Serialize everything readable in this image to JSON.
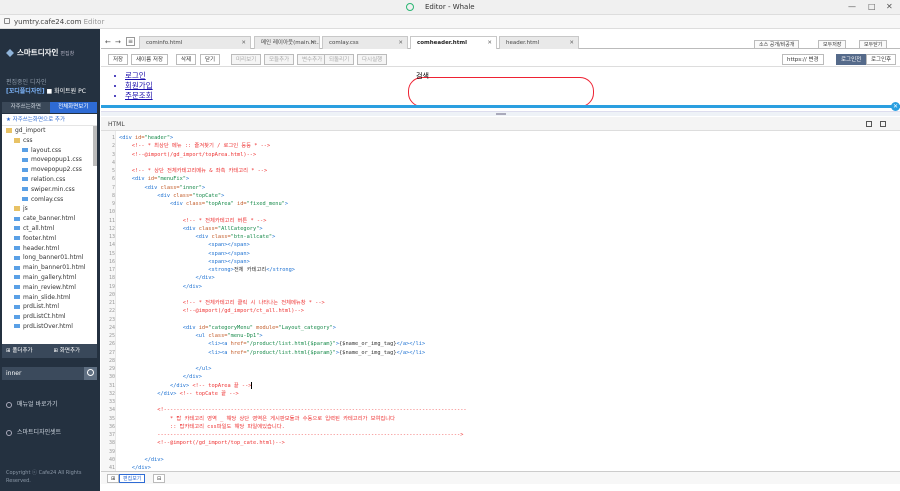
{
  "window": {
    "title": "Editor - Whale",
    "minimize": "—",
    "maximize": "□",
    "close": "✕"
  },
  "address": {
    "url": "yumtry.cafe24.com",
    "suffix": " Editor"
  },
  "sidebar": {
    "brand": "스마트디자인",
    "brand_sub": "편집창",
    "design_label": "편집중인 디자인",
    "design_name_prefix": "[꼬디플디자인]",
    "design_name": "■ 화이트원 PC",
    "tabs": [
      "자주쓰는화면",
      "전체화면보기"
    ],
    "favorites_add": "★ 자주쓰는화면으로 추가",
    "tree": [
      {
        "label": "gd_import",
        "type": "folder",
        "depth": 0
      },
      {
        "label": "css",
        "type": "folder",
        "depth": 1
      },
      {
        "label": "layout.css",
        "type": "file",
        "depth": 2
      },
      {
        "label": "movepopup1.css",
        "type": "file",
        "depth": 2
      },
      {
        "label": "movepopup2.css",
        "type": "file",
        "depth": 2
      },
      {
        "label": "relation.css",
        "type": "file",
        "depth": 2
      },
      {
        "label": "swiper.min.css",
        "type": "file",
        "depth": 2
      },
      {
        "label": "comlay.css",
        "type": "file",
        "depth": 2
      },
      {
        "label": "js",
        "type": "folder",
        "depth": 1
      },
      {
        "label": "cate_banner.html",
        "type": "file",
        "depth": 1
      },
      {
        "label": "ct_all.html",
        "type": "file",
        "depth": 1
      },
      {
        "label": "footer.html",
        "type": "file",
        "depth": 1
      },
      {
        "label": "header.html",
        "type": "file",
        "depth": 1
      },
      {
        "label": "long_banner01.html",
        "type": "file",
        "depth": 1
      },
      {
        "label": "main_banner01.html",
        "type": "file",
        "depth": 1
      },
      {
        "label": "main_gallery.html",
        "type": "file",
        "depth": 1
      },
      {
        "label": "main_review.html",
        "type": "file",
        "depth": 1
      },
      {
        "label": "main_slide.html",
        "type": "file",
        "depth": 1
      },
      {
        "label": "prdList.html",
        "type": "file",
        "depth": 1
      },
      {
        "label": "prdListCt.html",
        "type": "file",
        "depth": 1
      },
      {
        "label": "prdListOver.html",
        "type": "file",
        "depth": 1
      }
    ],
    "add_buttons": [
      "⊞ 폴더추가",
      "⊞ 화면추가"
    ],
    "search_value": "inner",
    "links": [
      "매뉴얼 바로가기",
      "스마트디자인셋트"
    ],
    "copyright": "Copyright ⓒ Cafe24 All Rights Reserved."
  },
  "tabs": [
    {
      "label": "cominfo.html",
      "active": false
    },
    {
      "label": "메인 레이아웃(main.ht...",
      "active": false
    },
    {
      "label": "comlay.css",
      "active": false
    },
    {
      "label": "comheader.html",
      "active": true
    },
    {
      "label": "header.html",
      "active": false
    }
  ],
  "tab_nav": {
    "back": "←",
    "forward": "→",
    "list": "≡"
  },
  "right_buttons": [
    "소스 공개/비공개",
    "모두저장",
    "모두닫기"
  ],
  "toolbar": {
    "left": [
      "저장",
      "새이름 저장",
      "삭제",
      "닫기"
    ],
    "mid": [
      "미리보기",
      "모듈추가",
      "변수추가",
      "되돌리기",
      "다시실행"
    ],
    "https": "https:// 변경",
    "right": [
      "로그인전",
      "로그인후"
    ]
  },
  "preview": {
    "links": [
      "로그인",
      "회원가입",
      "주문조회"
    ],
    "search_label": "검색"
  },
  "editor": {
    "mode": "HTML",
    "bottom": [
      "⊞",
      "편집보기",
      "⊟"
    ],
    "lines": [
      [
        [
          "t",
          "<div "
        ],
        [
          "a",
          "id="
        ],
        [
          "v",
          "\"header\""
        ],
        [
          "t",
          ">"
        ]
      ],
      [
        [
          "k",
          "    "
        ],
        [
          "c",
          "<!-- * 최상단 메뉴 :: 즐겨찾기 / 로그인 등등 * -->"
        ]
      ],
      [
        [
          "k",
          "    "
        ],
        [
          "c",
          "<!--@import(/gd_import/topArea.html)-->"
        ]
      ],
      [],
      [
        [
          "k",
          "    "
        ],
        [
          "c",
          "<!-- * 상단 전체카테고리메뉴 & 좌측 카테고리 * -->"
        ]
      ],
      [
        [
          "k",
          "    "
        ],
        [
          "t",
          "<div "
        ],
        [
          "a",
          "id="
        ],
        [
          "v",
          "\"menuFix\""
        ],
        [
          "t",
          ">"
        ]
      ],
      [
        [
          "k",
          "        "
        ],
        [
          "t",
          "<div "
        ],
        [
          "a",
          "class="
        ],
        [
          "v",
          "\"inner\""
        ],
        [
          "t",
          ">"
        ]
      ],
      [
        [
          "k",
          "            "
        ],
        [
          "t",
          "<div "
        ],
        [
          "a",
          "class="
        ],
        [
          "v",
          "\"topCate\""
        ],
        [
          "t",
          ">"
        ]
      ],
      [
        [
          "k",
          "                "
        ],
        [
          "t",
          "<div "
        ],
        [
          "a",
          "class="
        ],
        [
          "v",
          "\"topArea\" "
        ],
        [
          "a",
          "id="
        ],
        [
          "v",
          "\"fixed_menu\""
        ],
        [
          "t",
          ">"
        ]
      ],
      [],
      [
        [
          "k",
          "                    "
        ],
        [
          "c",
          "<!-- * 전체카테고리 버튼 * -->"
        ]
      ],
      [
        [
          "k",
          "                    "
        ],
        [
          "t",
          "<div "
        ],
        [
          "a",
          "class="
        ],
        [
          "v",
          "\"AllCategory\""
        ],
        [
          "t",
          ">"
        ]
      ],
      [
        [
          "k",
          "                        "
        ],
        [
          "t",
          "<div "
        ],
        [
          "a",
          "class="
        ],
        [
          "v",
          "\"btn-allcate\""
        ],
        [
          "t",
          ">"
        ]
      ],
      [
        [
          "k",
          "                            "
        ],
        [
          "t",
          "<span></span>"
        ]
      ],
      [
        [
          "k",
          "                            "
        ],
        [
          "t",
          "<span></span>"
        ]
      ],
      [
        [
          "k",
          "                            "
        ],
        [
          "t",
          "<span></span>"
        ]
      ],
      [
        [
          "k",
          "                            "
        ],
        [
          "t",
          "<strong>"
        ],
        [
          "k",
          "전체 카테고리"
        ],
        [
          "t",
          "</strong>"
        ]
      ],
      [
        [
          "k",
          "                        "
        ],
        [
          "t",
          "</div>"
        ]
      ],
      [
        [
          "k",
          "                    "
        ],
        [
          "t",
          "</div>"
        ]
      ],
      [],
      [
        [
          "k",
          "                    "
        ],
        [
          "c",
          "<!-- * 전체카테고리 클릭 시 나타나는 전체메뉴창 * -->"
        ]
      ],
      [
        [
          "k",
          "                    "
        ],
        [
          "c",
          "<!--@import(/gd_import/ct_all.html)-->"
        ]
      ],
      [],
      [
        [
          "k",
          "                    "
        ],
        [
          "t",
          "<div "
        ],
        [
          "a",
          "id="
        ],
        [
          "v",
          "\"categoryMenu\" "
        ],
        [
          "a",
          "module="
        ],
        [
          "v",
          "\"Layout_category\""
        ],
        [
          "t",
          ">"
        ]
      ],
      [
        [
          "k",
          "                        "
        ],
        [
          "t",
          "<ul "
        ],
        [
          "a",
          "class="
        ],
        [
          "v",
          "\"menu-Dp1\""
        ],
        [
          "t",
          ">"
        ]
      ],
      [
        [
          "k",
          "                            "
        ],
        [
          "t",
          "<li><a "
        ],
        [
          "a",
          "href="
        ],
        [
          "v",
          "\"/product/list.html{$param}\""
        ],
        [
          "t",
          ">"
        ],
        [
          "k",
          "{$name_or_img_tag}"
        ],
        [
          "t",
          "</a></li>"
        ]
      ],
      [
        [
          "k",
          "                            "
        ],
        [
          "t",
          "<li><a "
        ],
        [
          "a",
          "href="
        ],
        [
          "v",
          "\"/product/list.html{$param}\""
        ],
        [
          "t",
          ">"
        ],
        [
          "k",
          "{$name_or_img_tag}"
        ],
        [
          "t",
          "</a></li>"
        ]
      ],
      [],
      [
        [
          "k",
          "                        "
        ],
        [
          "t",
          "</ul>"
        ]
      ],
      [
        [
          "k",
          "                    "
        ],
        [
          "t",
          "</div>"
        ]
      ],
      [
        [
          "k",
          "                "
        ],
        [
          "t",
          "</div> "
        ],
        [
          "c",
          "<!-- topArea 끝 -->"
        ],
        [
          "cur",
          ""
        ]
      ],
      [
        [
          "k",
          "            "
        ],
        [
          "t",
          "</div> "
        ],
        [
          "c",
          "<!-- topCate 끝 -->"
        ]
      ],
      [],
      [
        [
          "k",
          "            "
        ],
        [
          "c",
          "<!-----------------------------------------------------------------------------------------------"
        ]
      ],
      [
        [
          "k",
          "                "
        ],
        [
          "c",
          "* 탑 카테고리 영역 _ 해당 상단 영역은 게시판모듈과 수동으로 입력된 카테고리가 보여집니다"
        ]
      ],
      [
        [
          "k",
          "                "
        ],
        [
          "c",
          ":: 탑카테고리 css파일도 해당 파일에있습니다."
        ]
      ],
      [
        [
          "k",
          "            "
        ],
        [
          "c",
          "----------------------------------------------------------------------------------------------->"
        ]
      ],
      [
        [
          "k",
          "            "
        ],
        [
          "c",
          "<!--@import(/gd_import/top_cate.html)-->"
        ]
      ],
      [],
      [
        [
          "k",
          "        "
        ],
        [
          "t",
          "</div>"
        ]
      ],
      [
        [
          "k",
          "    "
        ],
        [
          "t",
          "</div>"
        ]
      ]
    ]
  }
}
